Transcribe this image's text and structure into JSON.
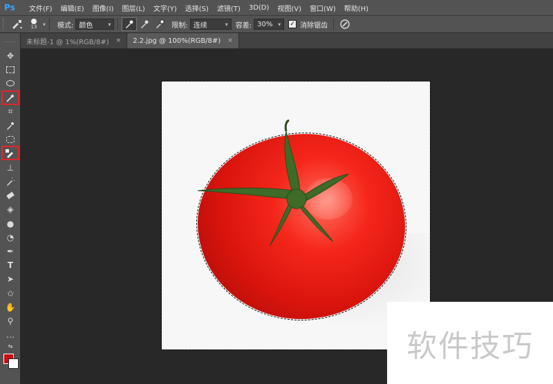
{
  "app": {
    "logo": "Ps"
  },
  "menu": [
    "文件(F)",
    "编辑(E)",
    "图像(I)",
    "图层(L)",
    "文字(Y)",
    "选择(S)",
    "滤镜(T)",
    "3D(D)",
    "视图(V)",
    "窗口(W)",
    "帮助(H)"
  ],
  "options": {
    "brush_size": "13",
    "mode_label": "模式:",
    "mode_value": "颜色",
    "limit_label": "限制:",
    "limit_value": "连续",
    "tolerance_label": "容差:",
    "tolerance_value": "30%",
    "antialias_label": "消除锯齿",
    "antialias_checked": true
  },
  "tabs": [
    {
      "label": "未标题-1 @ 1%(RGB/8#)",
      "close": "×",
      "active": false
    },
    {
      "label": "2.2.jpg @ 100%(RGB/8#)",
      "close": "×",
      "active": true
    }
  ],
  "toolbar": {
    "tools": [
      "move-icon",
      "marquee-icon",
      "lasso-icon",
      "magic-wand-icon",
      "crop-icon",
      "eyedropper-icon",
      "healing-icon",
      "color-replacement-icon",
      "stamp-icon",
      "history-brush-icon",
      "eraser-icon",
      "bucket-icon",
      "blur-icon",
      "dodge-icon",
      "pen-icon",
      "type-icon",
      "path-select-icon",
      "shape-icon",
      "hand-icon",
      "zoom-icon",
      "more-icon"
    ],
    "highlighted": [
      "magic-wand-icon",
      "color-replacement-icon"
    ],
    "type_glyph": "T",
    "more_glyph": "…"
  },
  "colors": {
    "foreground": "#cc0d0d",
    "background": "#ffffff",
    "highlight": "#e2262b"
  },
  "watermark": "软件技巧"
}
